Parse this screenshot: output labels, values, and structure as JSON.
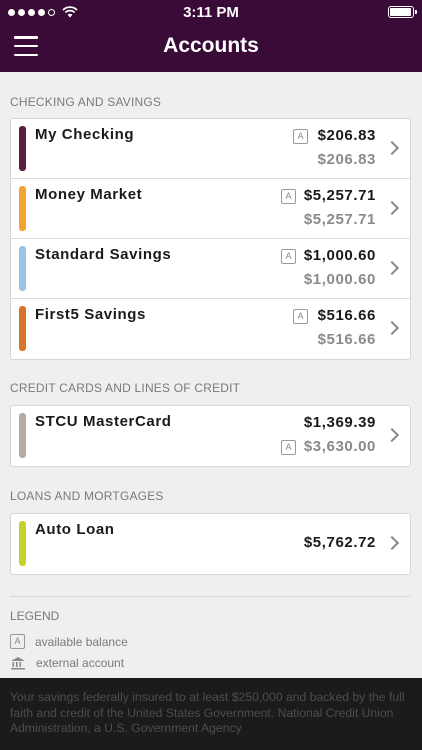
{
  "status": {
    "time": "3:11 PM"
  },
  "nav": {
    "title": "Accounts"
  },
  "sections": [
    {
      "header": "CHECKING AND SAVINGS"
    },
    {
      "header": "CREDIT CARDS AND LINES OF CREDIT"
    },
    {
      "header": "LOANS AND MORTGAGES"
    }
  ],
  "checking": [
    {
      "name": "My Checking",
      "balance": "$206.83",
      "available": "$206.83",
      "color": "#5b1e43"
    },
    {
      "name": "Money Market",
      "balance": "$5,257.71",
      "available": "$5,257.71",
      "color": "#f2a533"
    },
    {
      "name": "Standard Savings",
      "balance": "$1,000.60",
      "available": "$1,000.60",
      "color": "#9cc3e6"
    },
    {
      "name": "First5 Savings",
      "balance": "$516.66",
      "available": "$516.66",
      "color": "#d9752b"
    }
  ],
  "credit": [
    {
      "name": "STCU MasterCard",
      "balance": "$1,369.39",
      "available": "$3,630.00",
      "color": "#b8aaa4"
    }
  ],
  "loans": [
    {
      "name": "Auto Loan",
      "balance": "$5,762.72",
      "color": "#c7d12c"
    }
  ],
  "badge_letter": "A",
  "legend": {
    "title": "LEGEND",
    "available": "available balance",
    "external": "external account"
  },
  "footer": {
    "text": "Your savings federally insured to at least $250,000 and backed by the full faith and credit of the United States Government. National Credit Union Administration, a U.S. Government Agency"
  },
  "battery_level": 0.95
}
